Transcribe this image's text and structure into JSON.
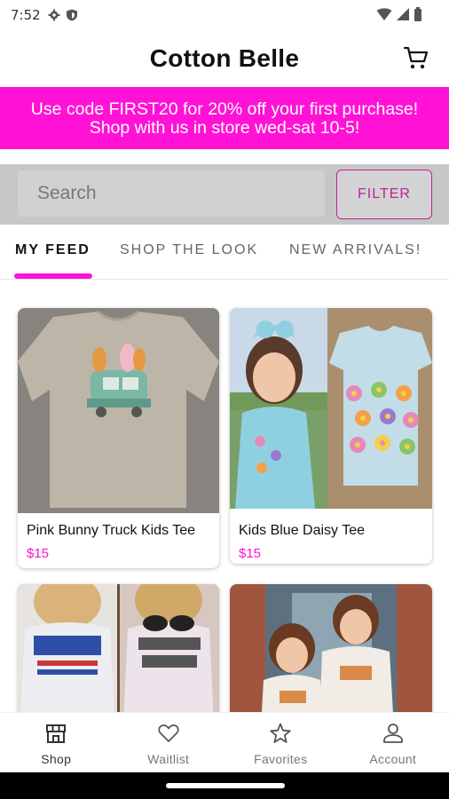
{
  "status_bar": {
    "time": "7:52"
  },
  "header": {
    "title": "Cotton Belle"
  },
  "promo": {
    "line1": "Use code FIRST20 for 20% off your first purchase!",
    "line2": "Shop with us in store wed-sat 10-5!"
  },
  "search": {
    "placeholder": "Search",
    "filter_label": "FILTER"
  },
  "tabs": [
    {
      "label": "MY FEED"
    },
    {
      "label": "SHOP THE LOOK"
    },
    {
      "label": "NEW ARRIVALS!"
    }
  ],
  "products": [
    {
      "name": "Pink Bunny Truck Kids Tee",
      "price": "$15"
    },
    {
      "name": "Kids Blue Daisy Tee",
      "price": "$15"
    },
    {
      "name": "",
      "price": ""
    },
    {
      "name": "",
      "price": ""
    }
  ],
  "bottom_nav": [
    {
      "label": "Shop",
      "icon": "store-icon"
    },
    {
      "label": "Waitlist",
      "icon": "heart-icon"
    },
    {
      "label": "Favorites",
      "icon": "star-icon"
    },
    {
      "label": "Account",
      "icon": "person-icon"
    }
  ],
  "colors": {
    "accent": "#ff12d6",
    "filter_border": "#b8259a",
    "search_bg": "#c7c7c7"
  }
}
